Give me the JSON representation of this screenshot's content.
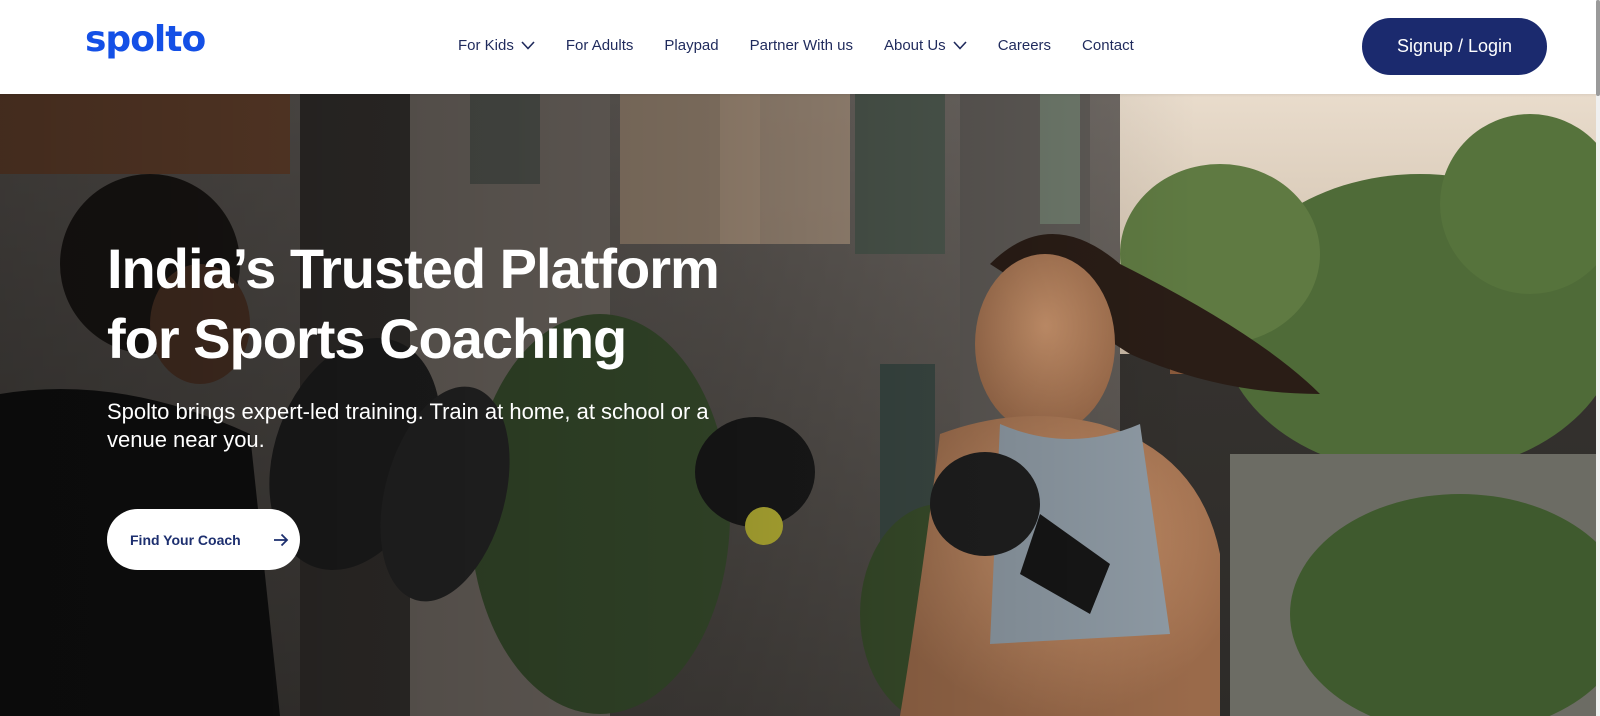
{
  "brand": {
    "name": "spolto",
    "color": "#1450e6"
  },
  "nav": {
    "items": [
      {
        "label": "For Kids",
        "has_dropdown": true
      },
      {
        "label": "For Adults",
        "has_dropdown": false
      },
      {
        "label": "Playpad",
        "has_dropdown": false
      },
      {
        "label": "Partner With us",
        "has_dropdown": false
      },
      {
        "label": "About Us",
        "has_dropdown": true
      },
      {
        "label": "Careers",
        "has_dropdown": false
      },
      {
        "label": "Contact",
        "has_dropdown": false
      }
    ],
    "dropdown_icon": "chevron-down-icon"
  },
  "auth": {
    "login_label": "Signup / Login",
    "color": "#1b2a6e"
  },
  "hero": {
    "title_line1": "India’s Trusted Platform",
    "title_line2": "for Sports Coaching",
    "subtitle": "Spolto brings expert-led training. Train at home, at school or a venue near you.",
    "cta_label": "Find Your Coach",
    "cta_icon": "arrow-right-icon"
  },
  "colors": {
    "nav_text": "#1f2a5c",
    "cta_text": "#1d2f6f",
    "hero_text": "#ffffff"
  }
}
